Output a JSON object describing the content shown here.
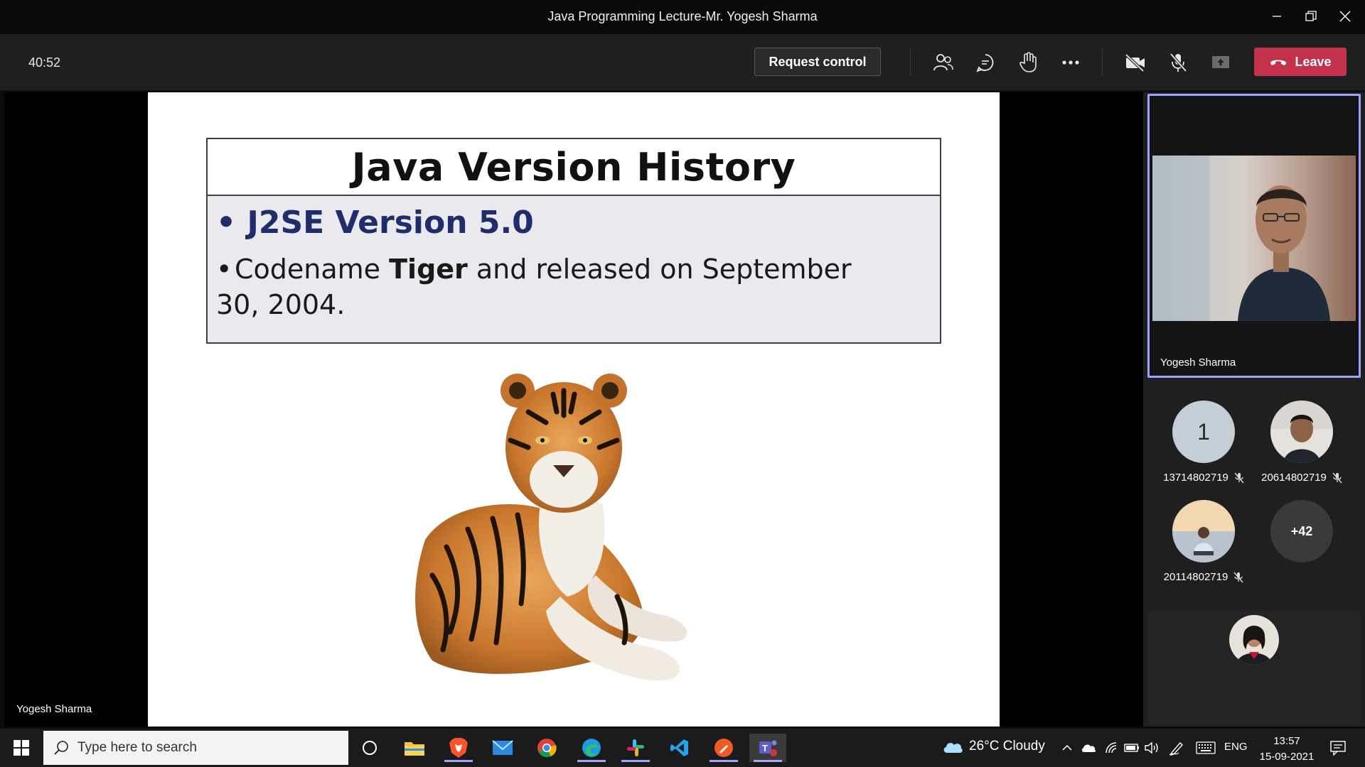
{
  "window": {
    "title": "Java Programming Lecture-Mr. Yogesh Sharma"
  },
  "toolbar": {
    "timer": "40:52",
    "request_control_label": "Request control",
    "leave_label": "Leave",
    "colors": {
      "leave": "#c4314b",
      "accent": "#9ea2ff"
    }
  },
  "slide": {
    "title": "Java Version History",
    "bullet1": "J2SE Version 5.0",
    "bullet2_pre": "Codename ",
    "bullet2_bold": "Tiger",
    "bullet2_post": " and released on September 30, 2004.",
    "image": "tiger-image"
  },
  "stage": {
    "presenter_name": "Yogesh Sharma"
  },
  "video": {
    "name": "Yogesh Sharma"
  },
  "participants": [
    {
      "avatar": "1",
      "label": "13714802719",
      "muted": true
    },
    {
      "avatar": "photo",
      "label": "20614802719",
      "muted": true
    },
    {
      "avatar": "photo",
      "label": "20114802719",
      "muted": true
    },
    {
      "avatar": "+42",
      "label": ""
    }
  ],
  "taskbar": {
    "search_placeholder": "Type here to search",
    "weather": "26°C  Cloudy",
    "lang": "ENG",
    "time": "13:57",
    "date": "15-09-2021"
  }
}
